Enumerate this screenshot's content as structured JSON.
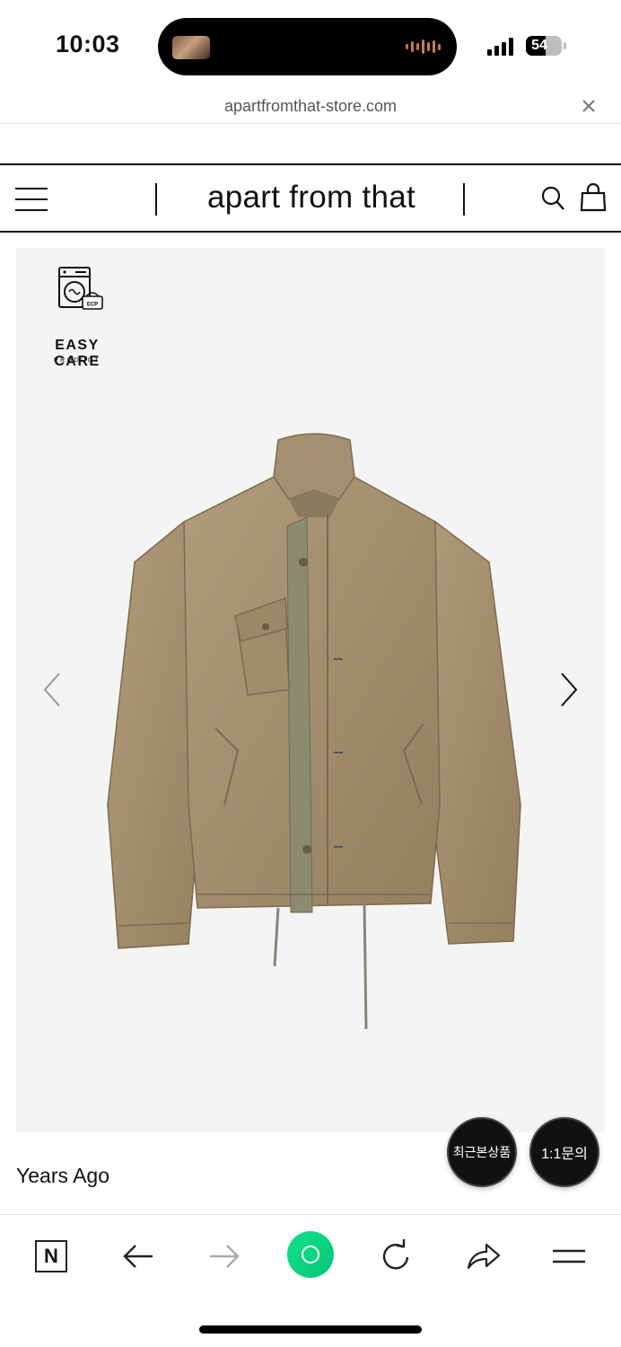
{
  "status_bar": {
    "time": "10:03",
    "battery_level": "54",
    "battery_fraction": 0.54
  },
  "browser": {
    "url": "apartfromthat-store.com",
    "close_icon": "close-icon"
  },
  "header": {
    "menu_icon": "hamburger-icon",
    "brand": "apart from that",
    "search_icon": "search-icon",
    "cart_icon": "shopping-bag-icon"
  },
  "product": {
    "badge_title": "EASY CARE",
    "badge_subtitle": "PRODUCT",
    "badge_code": "ECP",
    "image_subject": "khaki-jacket",
    "prev_icon": "chevron-left-icon",
    "next_icon": "chevron-right-icon",
    "title": "Years Ago"
  },
  "floating": {
    "recent_label": "최근본상품",
    "inquiry_label": "1:1문의"
  },
  "toolbar": {
    "naver_label": "N",
    "back_icon": "arrow-left-icon",
    "forward_icon": "arrow-right-icon",
    "home_icon": "green-circle-icon",
    "reload_icon": "reload-icon",
    "share_icon": "share-icon",
    "menu_icon": "menu-icon"
  },
  "colors": {
    "image_background": "#f4f4f4",
    "jacket": "#a48f70",
    "accent_green": "#0bd57f"
  }
}
